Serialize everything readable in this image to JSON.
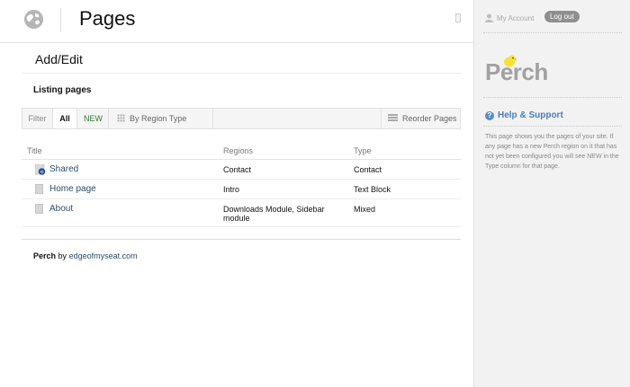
{
  "header": {
    "title": "Pages",
    "globe_icon": "globe-icon"
  },
  "subnav": {
    "label": "Add/Edit"
  },
  "section": {
    "heading": "Listing pages"
  },
  "filters": {
    "filter_label": "Filter",
    "all_label": "All",
    "new_label": "NEW",
    "region_label": "By Region Type",
    "reorder_label": "Reorder Pages",
    "new_color": "#2b7a2b"
  },
  "table": {
    "columns": [
      "Title",
      "Regions",
      "Type"
    ],
    "rows": [
      {
        "title": "Shared",
        "regions": "Contact",
        "type": "Contact",
        "icon": "shared-icon"
      },
      {
        "title": "Home page",
        "regions": "Intro",
        "type": "Text Block",
        "icon": "page-icon"
      },
      {
        "title": "About",
        "regions": "Downloads Module, Sidebar module",
        "type": "Mixed",
        "icon": "page-icon"
      }
    ]
  },
  "footer": {
    "brand": "Perch",
    "by": "by",
    "link": "edgeofmyseat.com"
  },
  "sidebar": {
    "my_account": "My Account",
    "logout": "Log out",
    "logo_text": "Perch",
    "help_title": "Help & Support",
    "help_text": "This page shows you the pages of your site. If any page has a new Perch region on it that has not yet been configured you will see NEW in the Type column for that page.",
    "accent": "#4a7fb8"
  }
}
